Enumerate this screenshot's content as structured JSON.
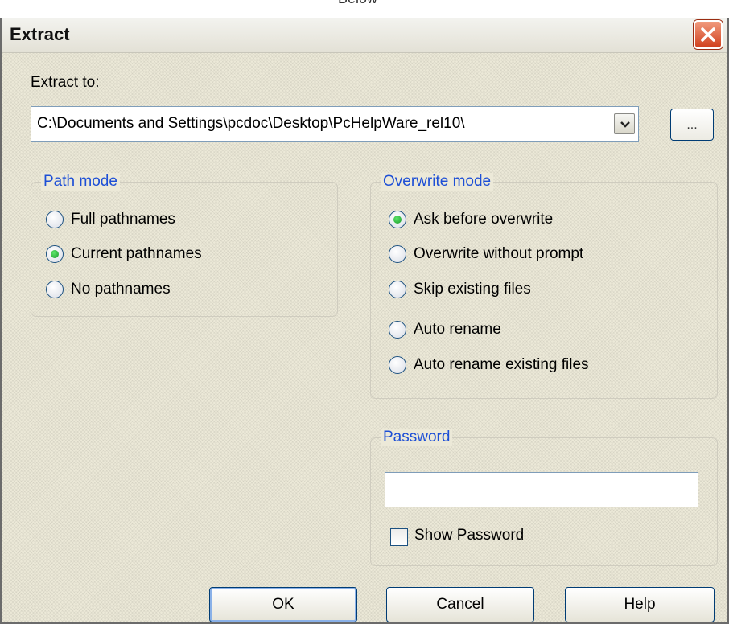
{
  "title": "Extract",
  "extract_to": {
    "label": "Extract to:",
    "path": "C:\\Documents and Settings\\pcdoc\\Desktop\\PcHelpWare_rel10\\",
    "browse_label": "..."
  },
  "path_mode": {
    "title": "Path mode",
    "options": [
      "Full pathnames",
      "Current pathnames",
      "No pathnames"
    ],
    "selected": "Current pathnames"
  },
  "overwrite_mode": {
    "title": "Overwrite mode",
    "options": [
      "Ask before overwrite",
      "Overwrite without prompt",
      "Skip existing files",
      "Auto rename",
      "Auto rename existing files"
    ],
    "selected": "Ask before overwrite"
  },
  "password": {
    "title": "Password",
    "value": "",
    "show_label": "Show Password",
    "show_checked": false
  },
  "buttons": {
    "ok": "OK",
    "cancel": "Cancel",
    "help": "Help"
  },
  "colors": {
    "accent": "#1d4fd6",
    "close": "#d1401e",
    "radio_dot": "#1a9a2b"
  }
}
